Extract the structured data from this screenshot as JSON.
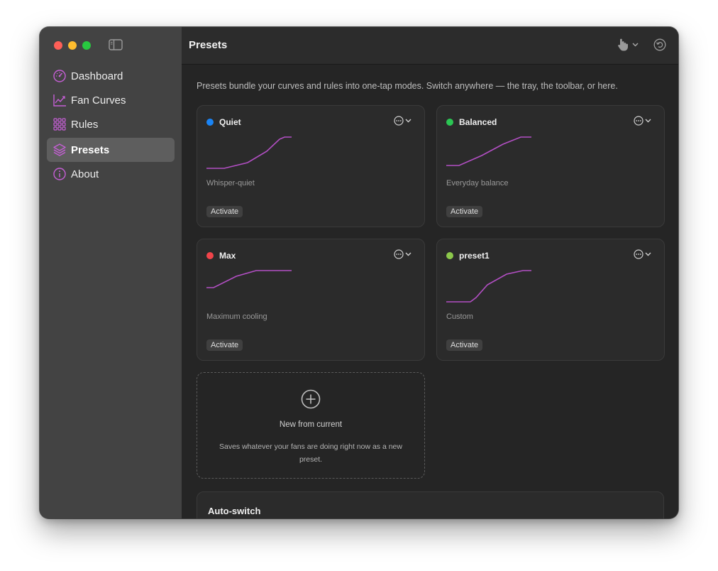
{
  "sidebar": {
    "items": [
      {
        "label": "Dashboard",
        "icon": "dashboard-gauge-icon",
        "active": false
      },
      {
        "label": "Fan Curves",
        "icon": "chart-line-icon",
        "active": false
      },
      {
        "label": "Rules",
        "icon": "grid-icon",
        "active": false
      },
      {
        "label": "Presets",
        "icon": "layers-icon",
        "active": true
      },
      {
        "label": "About",
        "icon": "info-icon",
        "active": false
      }
    ]
  },
  "toolbar": {
    "title": "Presets"
  },
  "main": {
    "intro": "Presets bundle your curves and rules into one-tap modes. Switch anywhere — the tray, the toolbar, or here.",
    "presets": [
      {
        "name": "Quiet",
        "color": "#1a84f5",
        "description": "Whisper-quiet",
        "activate_label": "Activate"
      },
      {
        "name": "Balanced",
        "color": "#2bc653",
        "description": "Everyday balance",
        "activate_label": "Activate"
      },
      {
        "name": "Max",
        "color": "#f0444a",
        "description": "Maximum cooling",
        "activate_label": "Activate"
      },
      {
        "name": "preset1",
        "color": "#8cc84b",
        "description": "Custom",
        "activate_label": "Activate"
      }
    ],
    "new_preset": {
      "title": "New from current",
      "description": "Saves whatever your fans are doing right now as a new preset."
    },
    "auto_switch": {
      "title": "Auto-switch"
    }
  },
  "colors": {
    "accent": "#c65fd6",
    "curve": "#b34fc4"
  }
}
